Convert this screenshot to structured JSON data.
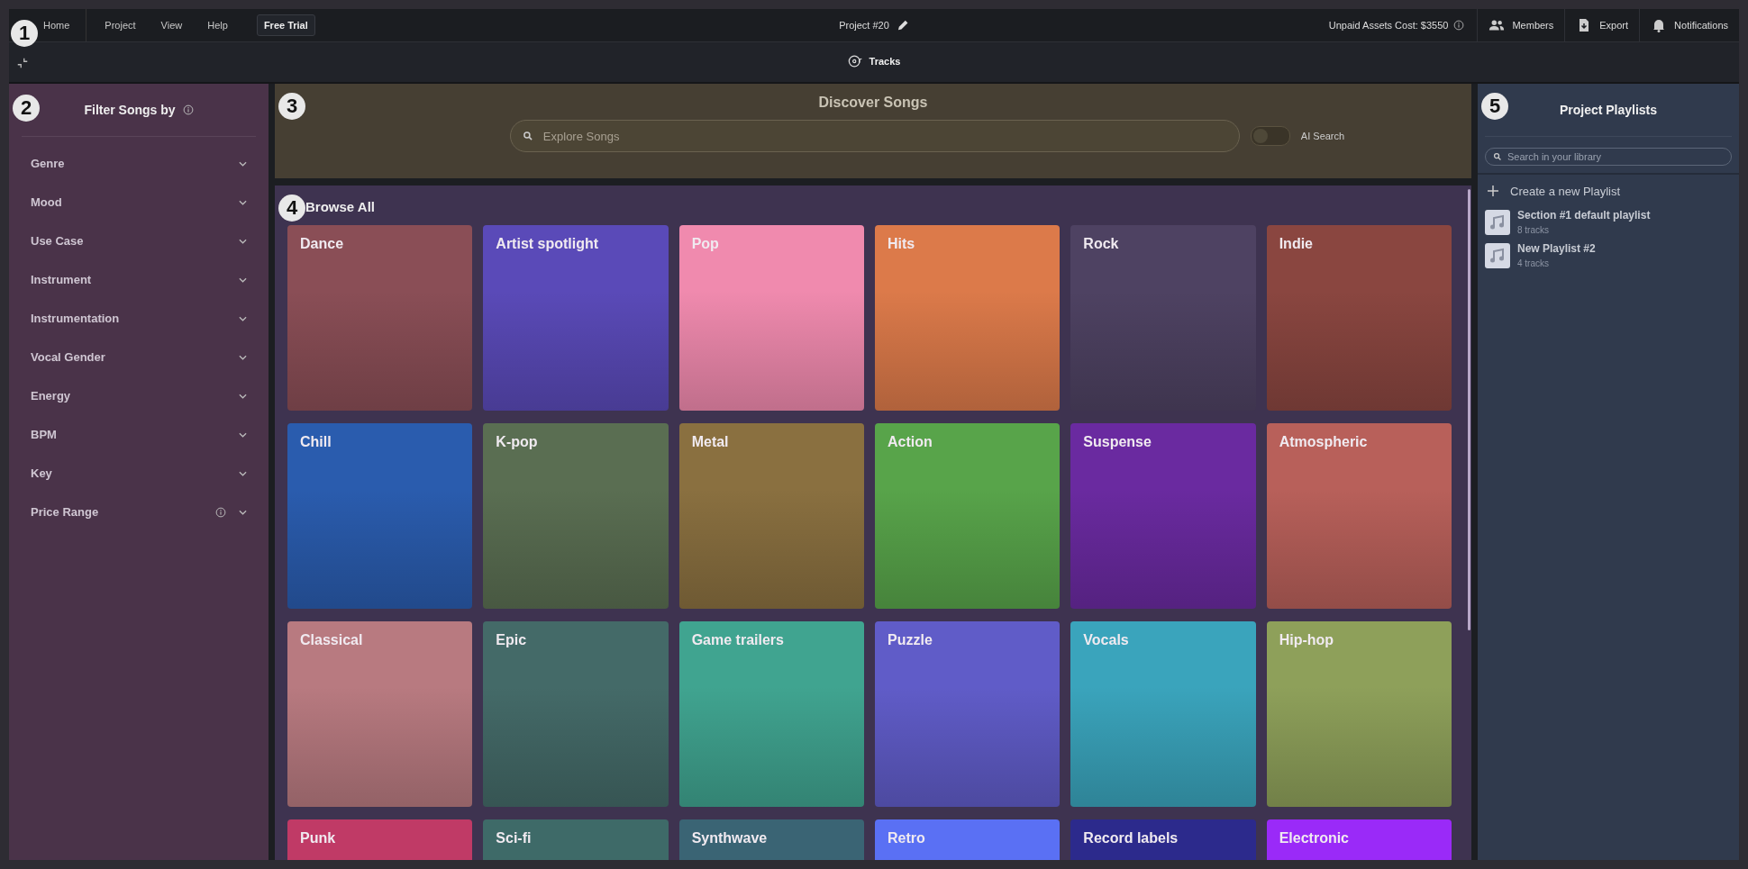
{
  "markers": [
    "1",
    "2",
    "3",
    "4",
    "5"
  ],
  "menu": {
    "home": "Home",
    "items": [
      "Project",
      "View",
      "Help"
    ],
    "trial_button": "Free Trial"
  },
  "project_title": "Project #20",
  "top_right": {
    "cost": "Unpaid Assets Cost: $3550",
    "actions": [
      {
        "kind": "members",
        "label": "Members"
      },
      {
        "kind": "export",
        "label": "Export"
      },
      {
        "kind": "notifications",
        "label": "Notifications"
      }
    ]
  },
  "tabs": [
    {
      "label": "Tracks",
      "selected": true
    }
  ],
  "filters": {
    "title": "Filter Songs by",
    "items": [
      {
        "label": "Genre",
        "info": false
      },
      {
        "label": "Mood",
        "info": false
      },
      {
        "label": "Use Case",
        "info": false
      },
      {
        "label": "Instrument",
        "info": false
      },
      {
        "label": "Instrumentation",
        "info": false
      },
      {
        "label": "Vocal Gender",
        "info": false
      },
      {
        "label": "Energy",
        "info": false
      },
      {
        "label": "BPM",
        "info": false
      },
      {
        "label": "Key",
        "info": false
      },
      {
        "label": "Price Range",
        "info": true
      }
    ]
  },
  "discover": {
    "title": "Discover Songs",
    "placeholder": "Explore Songs",
    "ai_search": {
      "label": "AI Search",
      "on": false
    }
  },
  "browse": {
    "title": "Browse All",
    "cards": [
      {
        "label": "Dance",
        "color": "#8a4e56"
      },
      {
        "label": "Artist spotlight",
        "color": "#5a4ab8"
      },
      {
        "label": "Pop",
        "color": "#f08aae"
      },
      {
        "label": "Hits",
        "color": "#dc7a4a"
      },
      {
        "label": "Rock",
        "color": "#4e4262"
      },
      {
        "label": "Indie",
        "color": "#8a4640"
      },
      {
        "label": "Chill",
        "color": "#2a5cae"
      },
      {
        "label": "K-pop",
        "color": "#5a6e52"
      },
      {
        "label": "Metal",
        "color": "#8a7040"
      },
      {
        "label": "Action",
        "color": "#58a44a"
      },
      {
        "label": "Suspense",
        "color": "#6a2aa0"
      },
      {
        "label": "Atmospheric",
        "color": "#b8605a"
      },
      {
        "label": "Classical",
        "color": "#b87a80"
      },
      {
        "label": "Epic",
        "color": "#446a68"
      },
      {
        "label": "Game trailers",
        "color": "#40a490"
      },
      {
        "label": "Puzzle",
        "color": "#605cc8"
      },
      {
        "label": "Vocals",
        "color": "#3aa4bc"
      },
      {
        "label": "Hip-hop",
        "color": "#8ea05a"
      },
      {
        "label": "Punk",
        "color": "#c03a66"
      },
      {
        "label": "Sci-fi",
        "color": "#3e6a68"
      },
      {
        "label": "Synthwave",
        "color": "#3a6474"
      },
      {
        "label": "Retro",
        "color": "#5a70f4"
      },
      {
        "label": "Record labels",
        "color": "#2c2a8c"
      },
      {
        "label": "Electronic",
        "color": "#9a2af8"
      }
    ]
  },
  "playlists": {
    "title": "Project Playlists",
    "placeholder": "Search in your library",
    "create": "Create a new Playlist",
    "items": [
      {
        "name": "Section #1 default playlist",
        "count": "8 tracks"
      },
      {
        "name": "New Playlist #2",
        "count": "4 tracks"
      }
    ]
  }
}
